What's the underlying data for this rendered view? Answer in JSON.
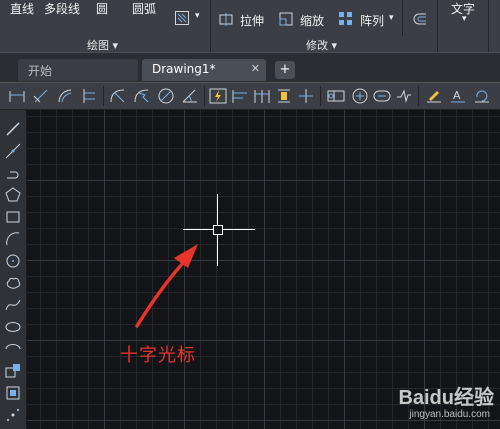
{
  "ribbon": {
    "draw_panel": {
      "line_label": "直线",
      "polyline_label": "多段线",
      "circle_label": "圆",
      "arc_label": "圆弧",
      "title": "绘图"
    },
    "modify_panel": {
      "stretch_label": "拉伸",
      "scale_label": "缩放",
      "array_label": "阵列",
      "title": "修改"
    },
    "text_label": "文字"
  },
  "tabs": [
    {
      "label": "开始"
    },
    {
      "label": "Drawing1*"
    }
  ],
  "tab_close_glyph": "✕",
  "tab_add_glyph": "+",
  "annotation": {
    "label": "十字光标",
    "color": "#e8342b"
  },
  "watermark": {
    "logo": "Baidu经验",
    "url": "jingyan.baidu.com"
  },
  "colors": {
    "canvas_bg": "#121418",
    "ribbon_bg": "#3b3f45",
    "crosshair": "#ffffff"
  }
}
